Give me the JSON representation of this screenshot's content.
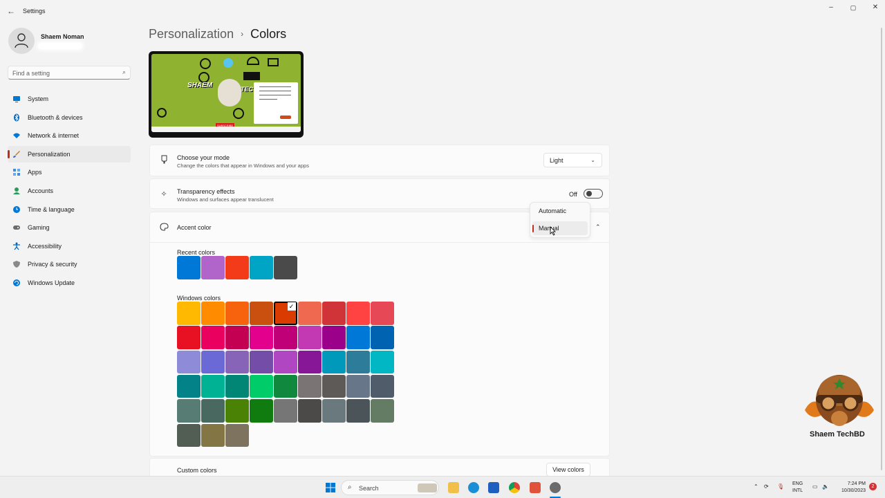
{
  "window": {
    "title": "Settings",
    "back_icon": "back-arrow-icon",
    "minimize_icon": "minimize-icon",
    "maximize_icon": "maximize-icon",
    "close_icon": "close-icon"
  },
  "user": {
    "name": "Shaem Noman"
  },
  "search": {
    "placeholder": "Find a setting",
    "icon": "search-icon"
  },
  "sidebar": {
    "items": [
      {
        "label": "System",
        "icon": "monitor-icon",
        "color": "#0078d4"
      },
      {
        "label": "Bluetooth & devices",
        "icon": "bluetooth-icon",
        "color": "#0067c0"
      },
      {
        "label": "Network & internet",
        "icon": "wifi-icon",
        "color": "#0078d4"
      },
      {
        "label": "Personalization",
        "icon": "brush-icon",
        "color": "#c87a2b"
      },
      {
        "label": "Apps",
        "icon": "apps-icon",
        "color": "#3b8ee0"
      },
      {
        "label": "Accounts",
        "icon": "account-icon",
        "color": "#2b9a5a"
      },
      {
        "label": "Time & language",
        "icon": "globe-clock-icon",
        "color": "#0078d4"
      },
      {
        "label": "Gaming",
        "icon": "gamepad-icon",
        "color": "#6b6b6b"
      },
      {
        "label": "Accessibility",
        "icon": "accessibility-icon",
        "color": "#0067c0"
      },
      {
        "label": "Privacy & security",
        "icon": "shield-icon",
        "color": "#6f6f6f"
      },
      {
        "label": "Windows Update",
        "icon": "update-icon",
        "color": "#0078d4"
      }
    ],
    "active_index": 3
  },
  "breadcrumb": {
    "parent": "Personalization",
    "separator": "›",
    "current": "Colors"
  },
  "preview": {
    "channel_text_1": "SHAEM",
    "channel_text_2": "TEC",
    "subscribe_text": "SUBSCRIBE"
  },
  "mode": {
    "title": "Choose your mode",
    "description": "Change the colors that appear in Windows and your apps",
    "value": "Light"
  },
  "transparency": {
    "title": "Transparency effects",
    "description": "Windows and surfaces appear translucent",
    "state_label": "Off"
  },
  "accent": {
    "title": "Accent color",
    "dropdown_options": [
      "Automatic",
      "Manual"
    ],
    "selected_option": "Manual",
    "accent_color": "#c42b1c"
  },
  "recent_colors": {
    "label": "Recent colors",
    "colors": [
      "#0078d7",
      "#b164c9",
      "#f33b1a",
      "#00a4c4",
      "#4a4a4a"
    ]
  },
  "windows_colors": {
    "label": "Windows colors",
    "selected": [
      0,
      4
    ],
    "rows": [
      [
        "#ffb900",
        "#ff8c00",
        "#f7630c",
        "#ca5010",
        "#da3b01",
        "#ef6950",
        "#d13438",
        "#ff4343",
        "#e74856"
      ],
      [
        "#e81123",
        "#ea005e",
        "#c30052",
        "#e3008c",
        "#bf0077",
        "#c239b3",
        "#9a0089",
        "#0078d7",
        "#0063b1"
      ],
      [
        "#8e8cd8",
        "#6b69d6",
        "#8764b8",
        "#744da9",
        "#b146c2",
        "#881798",
        "#0099bc",
        "#2d7d9a",
        "#00b7c3"
      ],
      [
        "#038387",
        "#00b294",
        "#018574",
        "#00cc6a",
        "#10893e",
        "#7a7574",
        "#5d5a58",
        "#68768a",
        "#515c6b"
      ],
      [
        "#567c73",
        "#486860",
        "#498205",
        "#107c10",
        "#767676",
        "#4c4a48",
        "#69797e",
        "#4a5459",
        "#647c64"
      ],
      [
        "#525e54",
        "#847545",
        "#7e735f"
      ]
    ]
  },
  "custom_colors": {
    "label": "Custom colors",
    "button_label": "View colors"
  },
  "watermark": {
    "text": "Shaem TechBD"
  },
  "taskbar": {
    "search_label": "Search",
    "language_line1": "ENG",
    "language_line2": "INTL",
    "time": "7:24 PM",
    "date": "10/30/2023",
    "notification_count": "2"
  }
}
